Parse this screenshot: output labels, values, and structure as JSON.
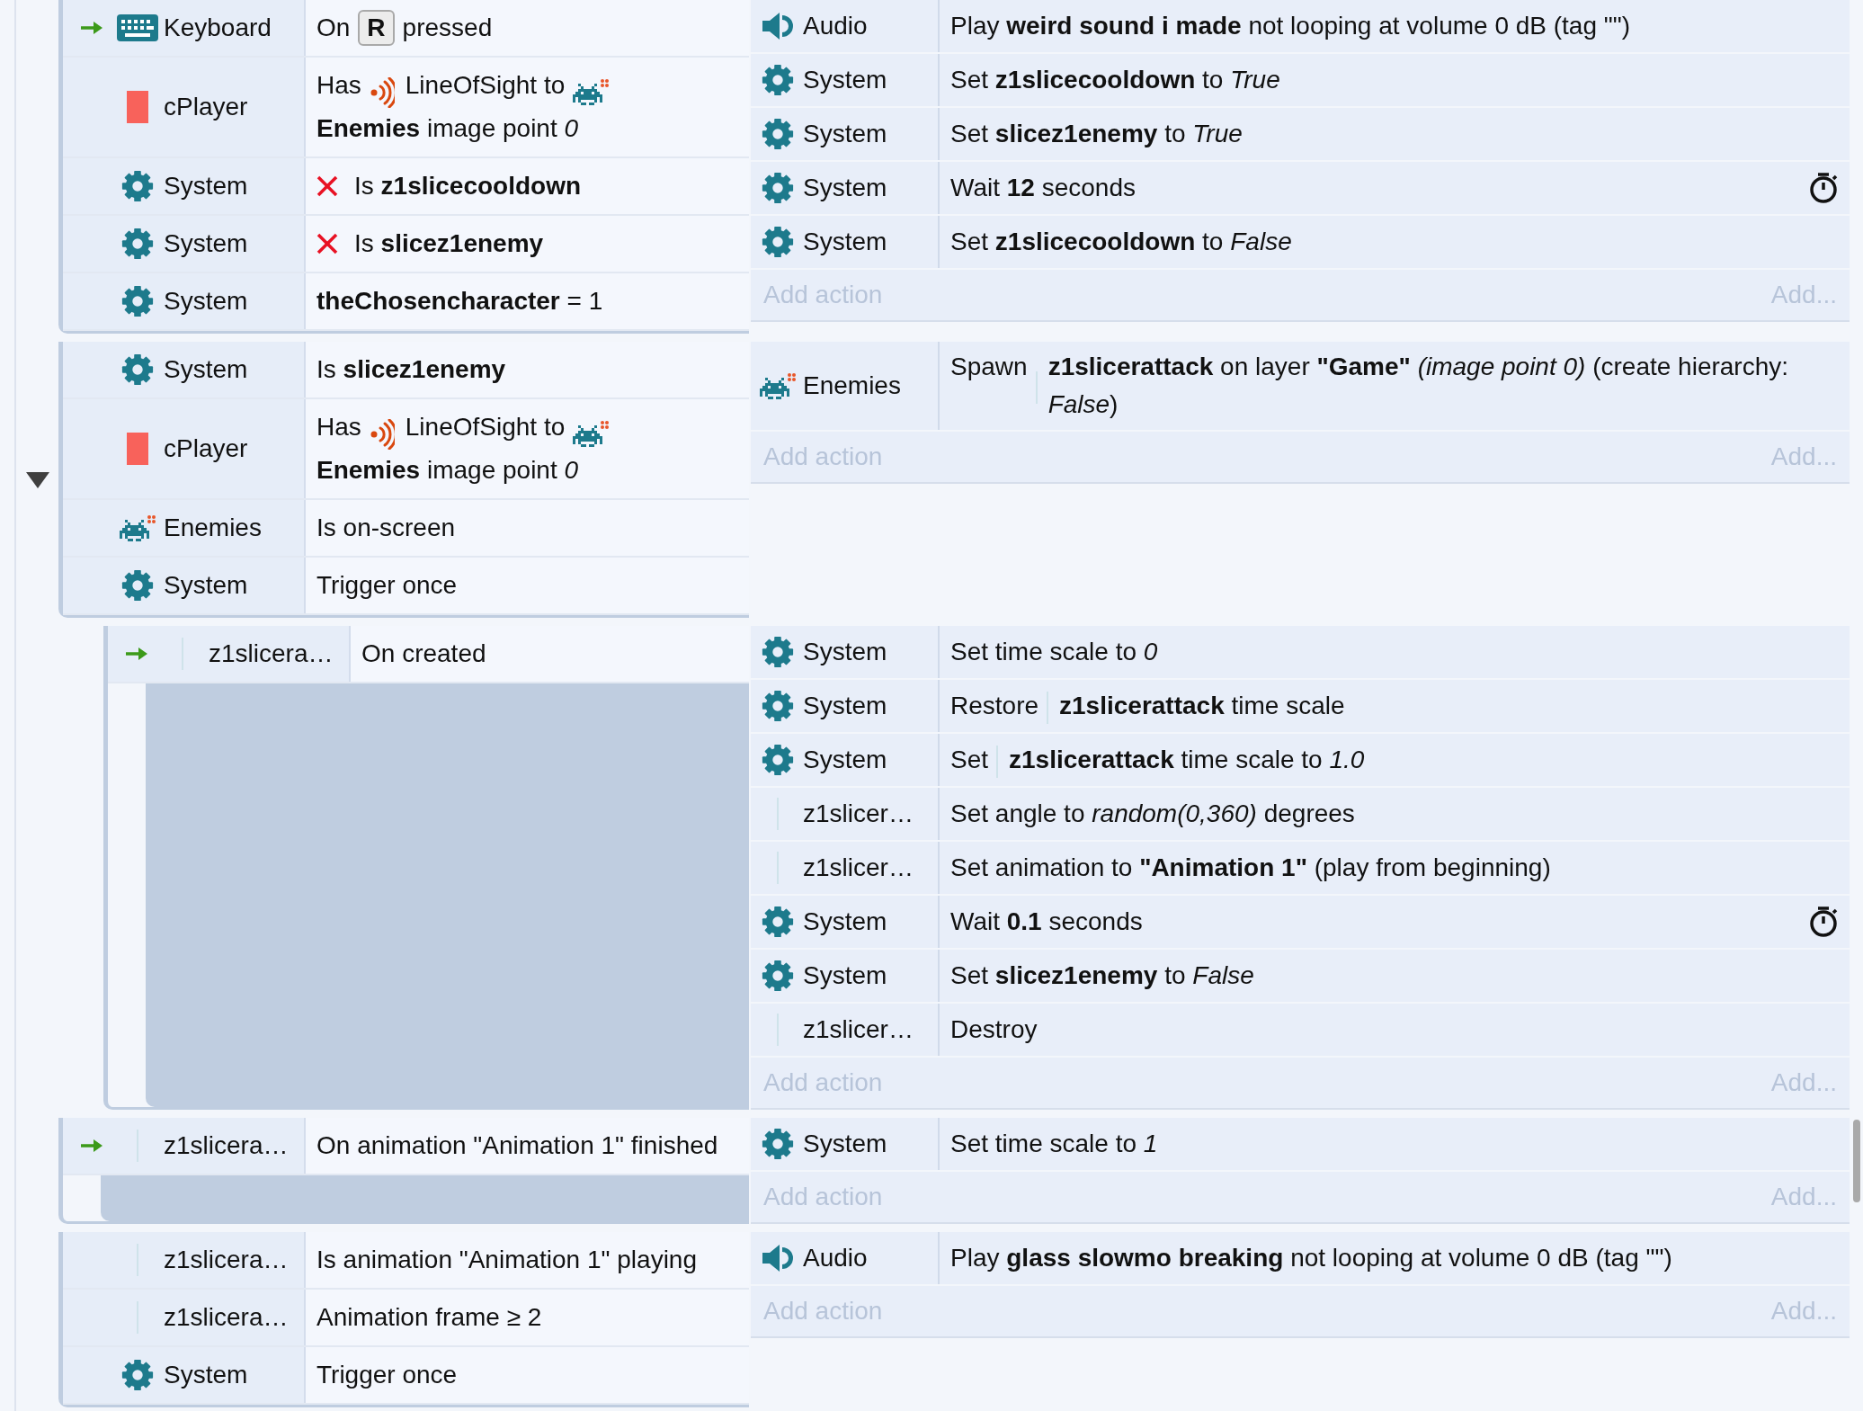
{
  "events": [
    {
      "conditions": [
        {
          "object": "Keyboard",
          "kind": "keyboard",
          "trigger": true,
          "inverted": false,
          "parts": [
            "On",
            {
              "key": "R"
            },
            "pressed"
          ]
        },
        {
          "object": "cPlayer",
          "kind": "sprite",
          "trigger": false,
          "inverted": false,
          "parts": [
            "Has",
            {
              "kind": "sight"
            },
            "LineOfSight to",
            {
              "kind": "enemies"
            },
            "**Enemies** image point *0*"
          ]
        },
        {
          "object": "System",
          "kind": "system",
          "trigger": false,
          "inverted": true,
          "parts": [
            "Is **z1slicecooldown**"
          ]
        },
        {
          "object": "System",
          "kind": "system",
          "trigger": false,
          "inverted": true,
          "parts": [
            "Is **slicez1enemy**"
          ]
        },
        {
          "object": "System",
          "kind": "system",
          "trigger": false,
          "inverted": false,
          "parts": [
            "**theChosencharacter** = 1"
          ]
        }
      ],
      "actions": [
        {
          "object": "Audio",
          "kind": "audio",
          "timer": false,
          "parts": [
            "Play **weird sound i made** not looping at volume 0 dB (tag \"\")"
          ]
        },
        {
          "object": "System",
          "kind": "system",
          "timer": false,
          "parts": [
            "Set **z1slicecooldown** to *True*"
          ]
        },
        {
          "object": "System",
          "kind": "system",
          "timer": false,
          "parts": [
            "Set **slicez1enemy** to *True*"
          ]
        },
        {
          "object": "System",
          "kind": "system",
          "timer": true,
          "parts": [
            "Wait **12** seconds"
          ]
        },
        {
          "object": "System",
          "kind": "system",
          "timer": false,
          "parts": [
            "Set **z1slicecooldown** to *False*"
          ]
        }
      ],
      "add_action": {
        "label": "Add action",
        "button": "Add..."
      }
    },
    {
      "expanded": true,
      "conditions": [
        {
          "object": "System",
          "kind": "system",
          "trigger": false,
          "inverted": false,
          "parts": [
            "Is **slicez1enemy**"
          ]
        },
        {
          "object": "cPlayer",
          "kind": "sprite",
          "trigger": false,
          "inverted": false,
          "parts": [
            "Has",
            {
              "kind": "sight"
            },
            "LineOfSight to",
            {
              "kind": "enemies"
            },
            "**Enemies** image point *0*"
          ]
        },
        {
          "object": "Enemies",
          "kind": "enemies",
          "trigger": false,
          "inverted": false,
          "parts": [
            "Is on-screen"
          ]
        },
        {
          "object": "System",
          "kind": "system",
          "trigger": false,
          "inverted": false,
          "parts": [
            "Trigger once"
          ]
        }
      ],
      "actions": [
        {
          "object": "Enemies",
          "kind": "enemies",
          "timer": false,
          "parts": [
            "Spawn",
            {
              "kind": "blank"
            },
            "**z1slicerattack** on layer **\"Game\"** *(image point 0)* (create hierarchy: *False*)"
          ]
        }
      ],
      "add_action": {
        "label": "Add action",
        "button": "Add..."
      },
      "sub_events": [
        {
          "conditions": [
            {
              "object": "z1slicera…",
              "kind": "blank",
              "trigger": true,
              "inverted": false,
              "parts": [
                "On created"
              ]
            }
          ],
          "actions": [
            {
              "object": "System",
              "kind": "system",
              "timer": false,
              "parts": [
                "Set time scale to *0*"
              ]
            },
            {
              "object": "System",
              "kind": "system",
              "timer": false,
              "parts": [
                "Restore",
                {
                  "kind": "blank"
                },
                "**z1slicerattack** time scale"
              ]
            },
            {
              "object": "System",
              "kind": "system",
              "timer": false,
              "parts": [
                "Set",
                {
                  "kind": "blank"
                },
                "**z1slicerattack** time scale to *1.0*"
              ]
            },
            {
              "object": "z1slicer…",
              "kind": "blank",
              "timer": false,
              "parts": [
                "Set angle to *random(0,360)* degrees"
              ]
            },
            {
              "object": "z1slicer…",
              "kind": "blank",
              "timer": false,
              "parts": [
                "Set animation to **\"Animation 1\"** (play from beginning)"
              ]
            },
            {
              "object": "System",
              "kind": "system",
              "timer": true,
              "parts": [
                "Wait **0.1** seconds"
              ]
            },
            {
              "object": "System",
              "kind": "system",
              "timer": false,
              "parts": [
                "Set **slicez1enemy** to *False*"
              ]
            },
            {
              "object": "z1slicer…",
              "kind": "blank",
              "timer": false,
              "parts": [
                "Destroy"
              ]
            }
          ],
          "add_action": {
            "label": "Add action",
            "button": "Add..."
          }
        }
      ]
    },
    {
      "conditions": [
        {
          "object": "z1slicera…",
          "kind": "blank",
          "trigger": true,
          "inverted": false,
          "parts": [
            "On animation \"Animation 1\" finished"
          ]
        }
      ],
      "actions": [
        {
          "object": "System",
          "kind": "system",
          "timer": false,
          "parts": [
            "Set time scale to *1*"
          ]
        }
      ],
      "add_action": {
        "label": "Add action",
        "button": "Add..."
      }
    },
    {
      "conditions": [
        {
          "object": "z1slicera…",
          "kind": "blank",
          "trigger": false,
          "inverted": false,
          "parts": [
            "Is animation \"Animation 1\" playing"
          ]
        },
        {
          "object": "z1slicera…",
          "kind": "blank",
          "trigger": false,
          "inverted": false,
          "parts": [
            "Animation frame ≥ 2"
          ]
        },
        {
          "object": "System",
          "kind": "system",
          "trigger": false,
          "inverted": false,
          "parts": [
            "Trigger once"
          ]
        }
      ],
      "actions": [
        {
          "object": "Audio",
          "kind": "audio",
          "timer": false,
          "parts": [
            "Play **glass slowmo breaking** not looping at volume 0 dB (tag \"\")"
          ]
        }
      ],
      "add_action": {
        "label": "Add action",
        "button": "Add..."
      }
    }
  ]
}
